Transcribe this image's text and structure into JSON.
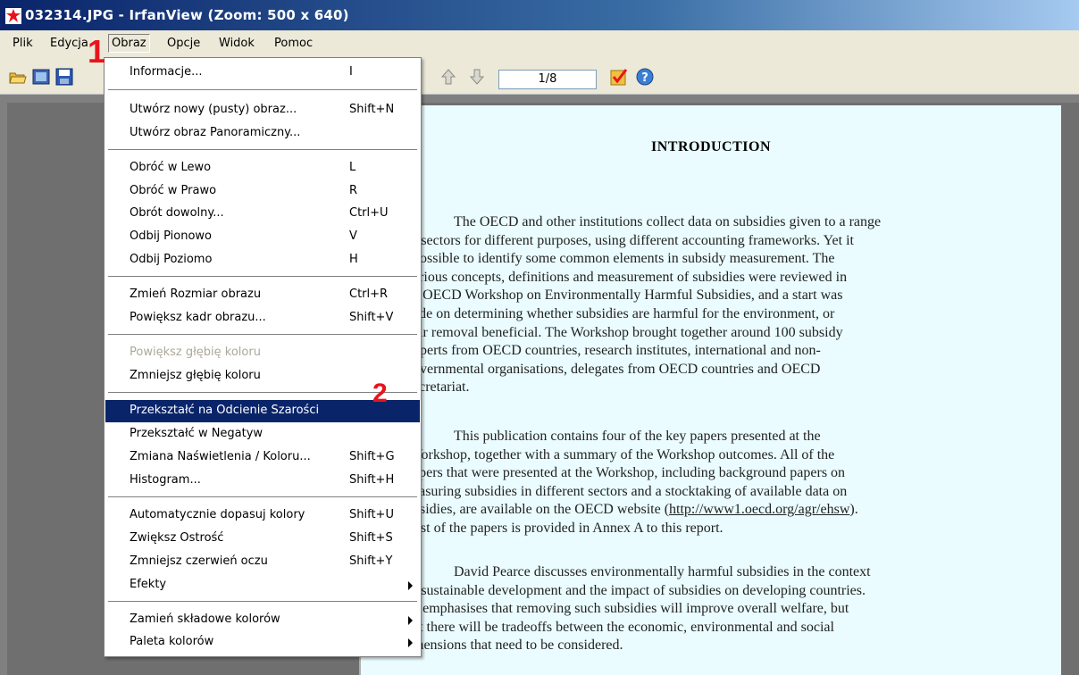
{
  "window": {
    "title": "032314.JPG - IrfanView (Zoom: 500 x 640)"
  },
  "menubar": {
    "items": [
      "Plik",
      "Edycja",
      "Obraz",
      "Opcje",
      "Widok",
      "Pomoc"
    ],
    "open_menu": "Obraz"
  },
  "toolbar": {
    "page_field": "1/8",
    "icons": [
      "open-folder-icon",
      "slideshow-icon",
      "save-icon",
      "previous-icon",
      "next-icon",
      "checkmark-icon",
      "help-icon"
    ]
  },
  "dropdown": {
    "items": [
      {
        "label": "Informacje...",
        "shortcut": "I"
      },
      {
        "label": "Utwórz nowy (pusty) obraz...",
        "shortcut": "Shift+N"
      },
      {
        "label": "Utwórz obraz Panoramiczny...",
        "shortcut": ""
      },
      {
        "label": "Obróć w Lewo",
        "shortcut": "L"
      },
      {
        "label": "Obróć w Prawo",
        "shortcut": "R"
      },
      {
        "label": "Obrót dowolny...",
        "shortcut": "Ctrl+U"
      },
      {
        "label": "Odbij Pionowo",
        "shortcut": "V"
      },
      {
        "label": "Odbij Poziomo",
        "shortcut": "H"
      },
      {
        "label": "Zmień Rozmiar obrazu",
        "shortcut": "Ctrl+R"
      },
      {
        "label": "Powiększ kadr obrazu...",
        "shortcut": "Shift+V"
      },
      {
        "label": "Powiększ głębię koloru",
        "shortcut": "",
        "disabled": true
      },
      {
        "label": "Zmniejsz głębię koloru",
        "shortcut": ""
      },
      {
        "label": "Przekształć na Odcienie Szarości",
        "shortcut": "",
        "highlighted": true
      },
      {
        "label": "Przekształć w Negatyw",
        "shortcut": ""
      },
      {
        "label": "Zmiana Naświetlenia / Koloru...",
        "shortcut": "Shift+G"
      },
      {
        "label": "Histogram...",
        "shortcut": "Shift+H"
      },
      {
        "label": "Automatycznie dopasuj kolory",
        "shortcut": "Shift+U"
      },
      {
        "label": "Zwiększ Ostrość",
        "shortcut": "Shift+S"
      },
      {
        "label": "Zmniejsz czerwień oczu",
        "shortcut": "Shift+Y"
      },
      {
        "label": "Efekty",
        "shortcut": "",
        "submenu": true
      },
      {
        "label": "Zamień składowe kolorów",
        "shortcut": "",
        "submenu": true
      },
      {
        "label": "Paleta kolorów",
        "shortcut": "",
        "submenu": true
      }
    ]
  },
  "annotations": {
    "marker_1": "1",
    "marker_2": "2"
  },
  "document": {
    "heading": "INTRODUCTION",
    "paragraphs": [
      [
        "The OECD and other institutions collect data on subsidies given to a range",
        "f sectors for different purposes, using different accounting frameworks. Yet it",
        "possible to identify some common elements in subsidy measurement. The",
        "arious concepts, definitions and measurement of subsidies were reviewed in",
        "e OECD Workshop on Environmentally Harmful Subsidies, and a start was",
        "ade on determining whether subsidies are harmful for the environment, or",
        "eir removal beneficial. The Workshop brought together around 100 subsidy",
        "xperts from OECD countries, research institutes, international and non-",
        "overnmental organisations, delegates from OECD countries and OECD",
        "ecretariat."
      ],
      [
        "This publication contains four of the key papers presented at the",
        "Vorkshop, together with a summary of the Workshop outcomes. All of the",
        "apers that were presented at the Workshop, including background papers on",
        "easuring subsidies in different sectors and a stocktaking of available data on",
        "bsidies, are available on the OECD website (http://www1.oecd.org/agr/ehsw).",
        "list of the papers is provided in Annex A to this report."
      ],
      [
        "David Pearce discusses environmentally harmful subsidies in the context",
        "f sustainable development and the impact of subsidies on developing countries.",
        "e emphasises that removing such subsidies will improve overall welfare, but",
        "at there will be tradeoffs between the economic, environmental and social",
        "mensions that need to be considered."
      ]
    ]
  },
  "colors": {
    "highlight": "#0a246a",
    "marker": "#e8141c",
    "page_background": "#eafcff"
  }
}
